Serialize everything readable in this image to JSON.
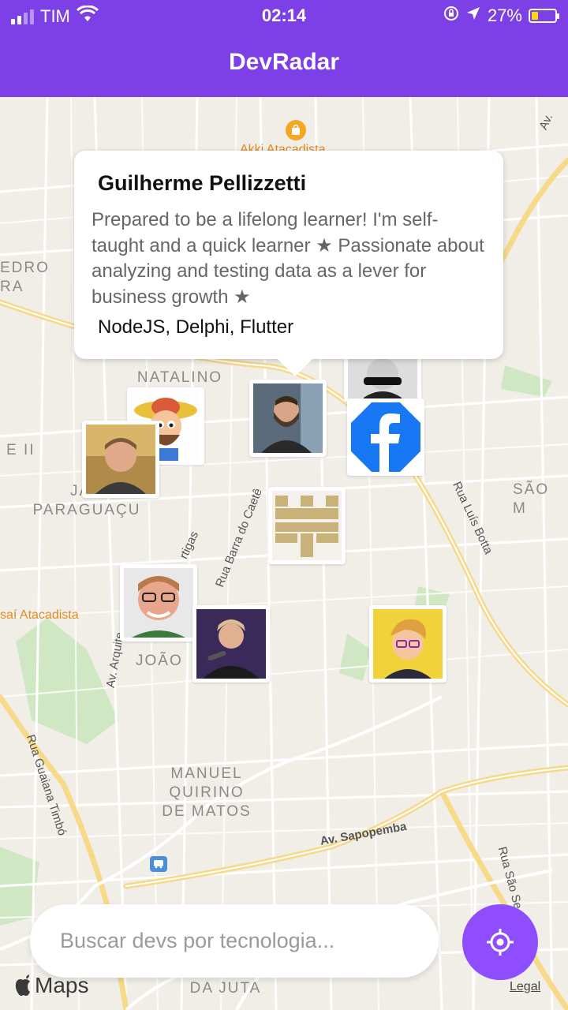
{
  "status_bar": {
    "carrier": "TIM",
    "time": "02:14",
    "battery": "27%",
    "battery_level": 0.27
  },
  "header": {
    "title": "DevRadar"
  },
  "map": {
    "areas": [
      "NATALINO\nDA",
      "JAR\nPARAGUAÇU",
      "SÃO M",
      "JOÃO",
      "MANUEL\nQUIRINO\nDE MATOS",
      "DA JUTA",
      "EDRO RA",
      "E II"
    ],
    "streets": [
      "Rua Barra do Caetê",
      "Rua Luís Botta",
      "Av. Arquite",
      "Rua Guaiana Timbó",
      "Av. Sapopemba",
      "Rua São Se",
      "Av.",
      "rtigas"
    ],
    "pois": [
      "Akki Atacadista",
      "saí Atacadista"
    ],
    "brand": "Maps",
    "legal": "Legal"
  },
  "callout": {
    "name": "Guilherme Pellizzetti",
    "bio": " Prepared to be a lifelong learner! I'm self-taught and a quick learner ★ Passionate about analyzing and testing data as a lever for business growth ★",
    "techs": "NodeJS, Delphi, Flutter"
  },
  "search": {
    "placeholder": "Buscar devs por tecnologia..."
  },
  "colors": {
    "primary": "#7d40e7",
    "button": "#8e4dff"
  },
  "icons": [
    "wifi-icon",
    "lock-rotation-icon",
    "location-arrow-icon",
    "battery-icon",
    "gps-target-icon",
    "apple-icon",
    "bus-stop-icon",
    "shopping-bag-icon"
  ]
}
